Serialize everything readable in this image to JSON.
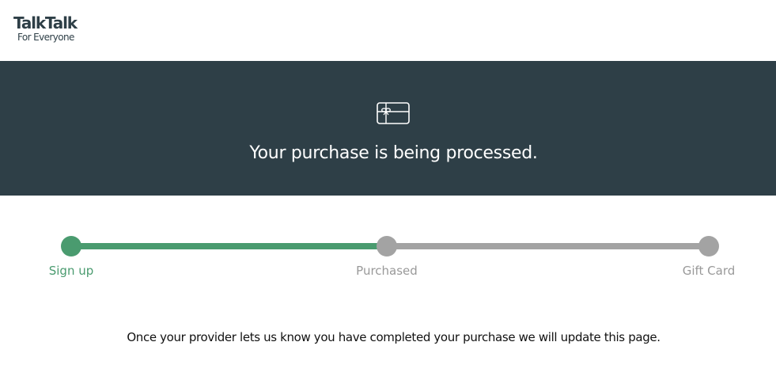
{
  "header": {
    "logo": {
      "brand": "TalkTalk",
      "tagline": "For Everyone"
    }
  },
  "banner": {
    "icon": "gift-card-icon",
    "title": "Your purchase is being processed.",
    "background_color": "#2e3f47"
  },
  "progress": {
    "steps": [
      {
        "label": "Sign up",
        "status": "complete"
      },
      {
        "label": "Purchased",
        "status": "pending"
      },
      {
        "label": "Gift Card",
        "status": "pending"
      }
    ],
    "complete_color": "#4a9b6f",
    "pending_color": "#a3a3a3"
  },
  "message": {
    "text": "Once your provider lets us know you have completed your purchase we will update this page."
  }
}
